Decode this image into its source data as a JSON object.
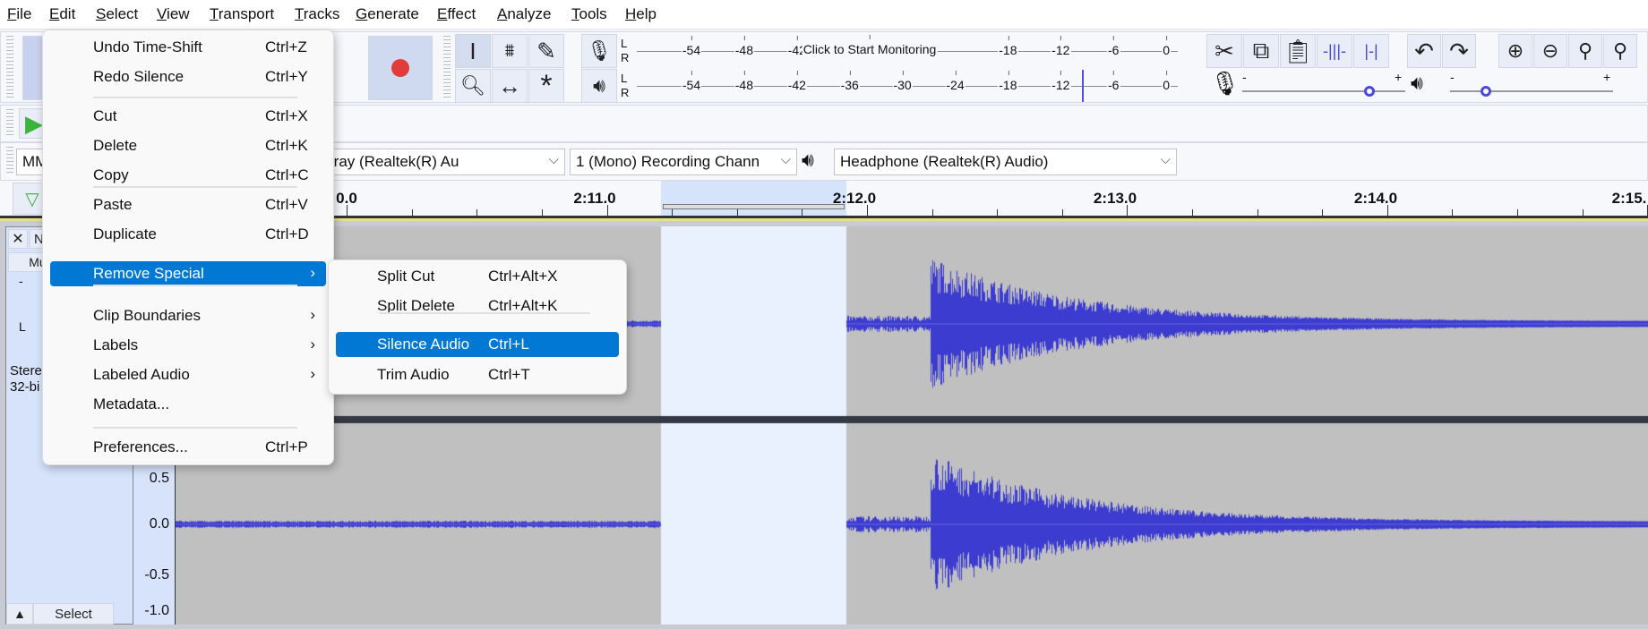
{
  "menubar": [
    "File",
    "Edit",
    "Select",
    "View",
    "Transport",
    "Tracks",
    "Generate",
    "Effect",
    "Analyze",
    "Tools",
    "Help"
  ],
  "meters": {
    "record_ticks": [
      "-54",
      "-48",
      "-42",
      "-18",
      "-12",
      "-6",
      "0"
    ],
    "record_prompt": "Click to Start Monitoring",
    "play_ticks": [
      "-54",
      "-48",
      "-42",
      "-36",
      "-30",
      "-24",
      "-18",
      "-12",
      "-6",
      "0"
    ],
    "l": "L",
    "r": "R"
  },
  "mixer": {
    "minus": "-",
    "plus": "+",
    "record_volume": 0.78,
    "playback_volume": 0.22
  },
  "devices": {
    "host": "MM",
    "input": "rray (Realtek(R) Au",
    "channels": "1 (Mono) Recording Chann",
    "output": "Headphone (Realtek(R) Audio)"
  },
  "ruler": {
    "labels": [
      "0.0",
      "2:11.0",
      "2:12.0",
      "2:13.0",
      "2:14.0",
      "2:15."
    ]
  },
  "track": {
    "close": "✕",
    "name": "N",
    "mute": "Mu",
    "gain": "-",
    "pan": "L",
    "info1": "Stere",
    "info2": "32-bi",
    "select": "Select",
    "scale": [
      "0.5",
      "0.0",
      "-0.5",
      "-1.0"
    ]
  },
  "colors": {
    "waveform": "#3c3cd0",
    "selection": "#e9f1fe",
    "accent": "#0078d4"
  },
  "edit_menu": {
    "items": [
      {
        "label": "Undo Time-Shift",
        "shortcut": "Ctrl+Z"
      },
      {
        "label": "Redo Silence",
        "shortcut": "Ctrl+Y"
      },
      {
        "label": "Cut",
        "shortcut": "Ctrl+X"
      },
      {
        "label": "Delete",
        "shortcut": "Ctrl+K"
      },
      {
        "label": "Copy",
        "shortcut": "Ctrl+C"
      },
      {
        "label": "Paste",
        "shortcut": "Ctrl+V"
      },
      {
        "label": "Duplicate",
        "shortcut": "Ctrl+D"
      },
      {
        "label": "Remove Special",
        "submenu": true
      },
      {
        "label": "Clip Boundaries",
        "submenu": true
      },
      {
        "label": "Labels",
        "submenu": true
      },
      {
        "label": "Labeled Audio",
        "submenu": true
      },
      {
        "label": "Metadata..."
      },
      {
        "label": "Preferences...",
        "shortcut": "Ctrl+P"
      }
    ]
  },
  "submenu": {
    "items": [
      {
        "label": "Split Cut",
        "shortcut": "Ctrl+Alt+X"
      },
      {
        "label": "Split Delete",
        "shortcut": "Ctrl+Alt+K"
      },
      {
        "label": "Silence Audio",
        "shortcut": "Ctrl+L"
      },
      {
        "label": "Trim Audio",
        "shortcut": "Ctrl+T"
      }
    ]
  }
}
